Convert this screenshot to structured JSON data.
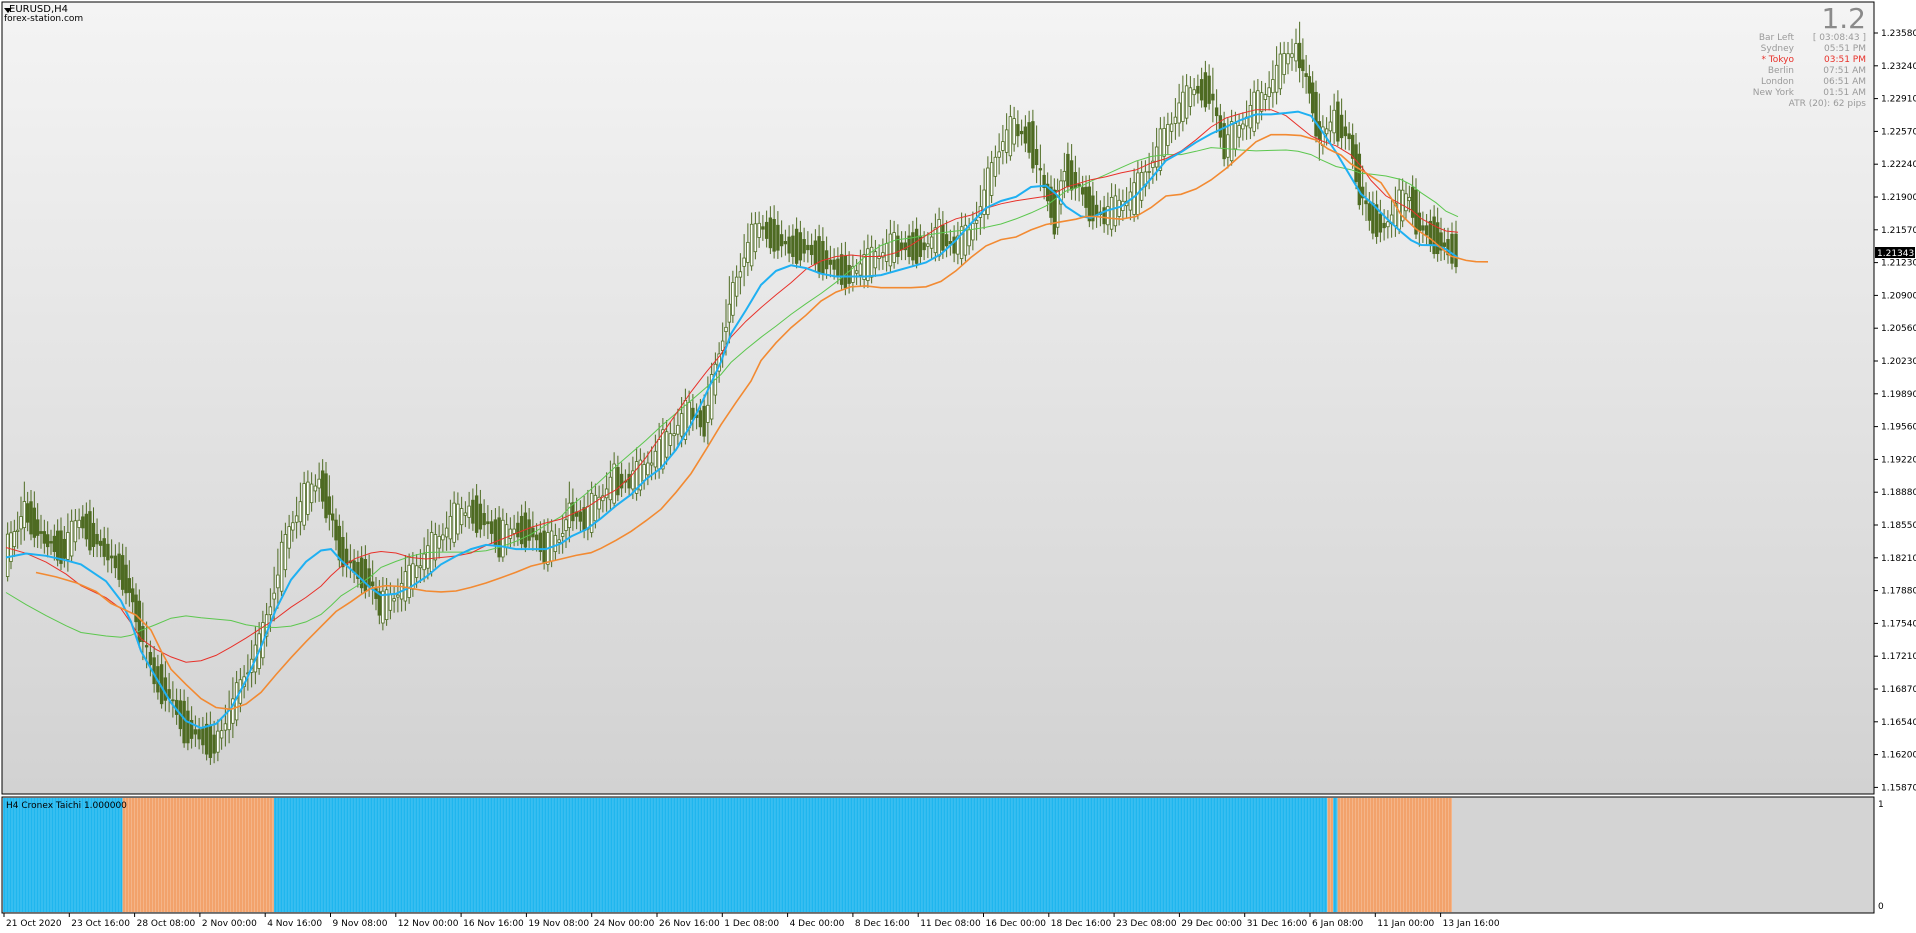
{
  "window": {
    "symbol": "EURUSD,H4",
    "source": "forex-station.com"
  },
  "price_scale": {
    "levels": [
      "1.23580",
      "1.23240",
      "1.22910",
      "1.22570",
      "1.22240",
      "1.21900",
      "1.21570",
      "1.21230",
      "1.20900",
      "1.20560",
      "1.20230",
      "1.19890",
      "1.19560",
      "1.19220",
      "1.18880",
      "1.18550",
      "1.18210",
      "1.17880",
      "1.17540",
      "1.17210",
      "1.16870",
      "1.16540",
      "1.16200",
      "1.15870"
    ],
    "current_price": "1.21343"
  },
  "time_scale": {
    "labels": [
      "21 Oct 2020",
      "23 Oct 16:00",
      "28 Oct 08:00",
      "2 Nov 00:00",
      "4 Nov 16:00",
      "9 Nov 08:00",
      "12 Nov 00:00",
      "16 Nov 16:00",
      "19 Nov 08:00",
      "24 Nov 00:00",
      "26 Nov 16:00",
      "1 Dec 08:00",
      "4 Dec 00:00",
      "8 Dec 16:00",
      "11 Dec 08:00",
      "16 Dec 00:00",
      "18 Dec 16:00",
      "23 Dec 08:00",
      "29 Dec 00:00",
      "31 Dec 16:00",
      "6 Jan 08:00",
      "11 Jan 00:00",
      "13 Jan 16:00"
    ]
  },
  "info_panel": {
    "big_value": "1.2",
    "rows": [
      {
        "label": "Bar Left",
        "value": "[ 03:08:43 ]",
        "highlight": false
      },
      {
        "label": "Sydney",
        "value": "05:51 PM",
        "highlight": false
      },
      {
        "label": "* Tokyo",
        "value": "03:51 PM",
        "highlight": true
      },
      {
        "label": "Berlin",
        "value": "07:51 AM",
        "highlight": false
      },
      {
        "label": "London",
        "value": "06:51 AM",
        "highlight": false
      },
      {
        "label": "New York",
        "value": "01:51 AM",
        "highlight": false
      }
    ],
    "atr": "ATR (20): 62 pips"
  },
  "subwindow": {
    "label": "H4 Cronex Taichi 1.000000",
    "scale_top": "1",
    "scale_bottom": "0",
    "segments": [
      {
        "state": "up",
        "from": 0,
        "to": 0.0825
      },
      {
        "state": "down",
        "from": 0.0825,
        "to": 0.187
      },
      {
        "state": "up",
        "from": 0.187,
        "to": 0.914
      },
      {
        "state": "down",
        "from": 0.914,
        "to": 0.918
      },
      {
        "state": "up",
        "from": 0.918,
        "to": 0.921
      },
      {
        "state": "down",
        "from": 0.921,
        "to": 1.0
      }
    ]
  },
  "colors": {
    "up": "#1fb6ee",
    "down": "#f2a26b",
    "candle_body": "#4e6b22",
    "ma_red": "#e8312a",
    "ma_green": "#5cc74e",
    "line_blue": "#1fb0f2",
    "line_orange": "#f28a32",
    "tokyo": "#e8312a",
    "price_tag_bg": "#000000"
  }
}
